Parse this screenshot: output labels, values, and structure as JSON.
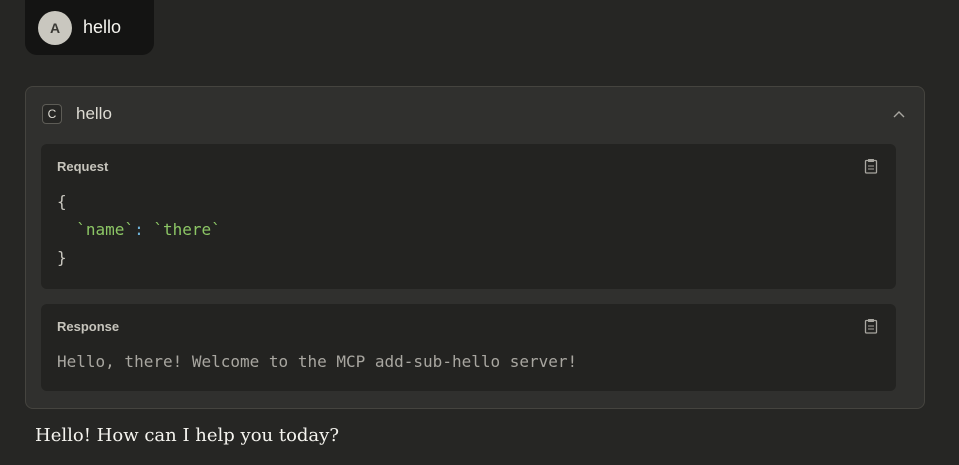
{
  "user_message": {
    "avatar_initial": "A",
    "text": "hello"
  },
  "tool_call": {
    "icon_letter": "C",
    "name": "hello",
    "expanded": true,
    "collapse_icon": "chevron-up-icon",
    "request": {
      "label": "Request",
      "open_brace": "{",
      "key": "`name`",
      "separator": ":",
      "value": "`there`",
      "close_brace": "}",
      "copy_icon": "clipboard-icon"
    },
    "response": {
      "label": "Response",
      "text": "Hello, there! Welcome to the MCP add-sub-hello server!",
      "copy_icon": "clipboard-icon"
    }
  },
  "assistant_message": {
    "text": "Hello! How can I help you today?"
  },
  "colors": {
    "background": "#262624",
    "user_bubble": "#141413",
    "card": "#30302e",
    "panel": "#232321",
    "string_green": "#8cc665",
    "colon_blue": "#6fb3d9"
  }
}
